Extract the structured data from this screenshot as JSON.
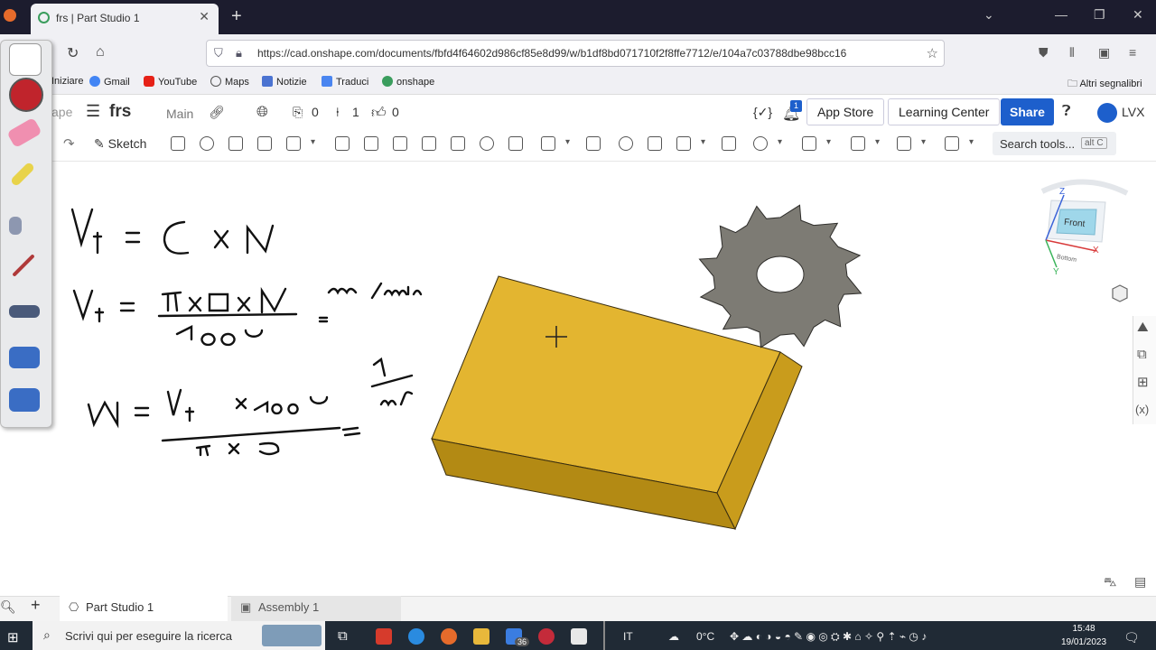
{
  "browser": {
    "tab_title": "frs | Part Studio 1",
    "tab_close": "✕",
    "new_tab": "+",
    "url": "https://cad.onshape.com/documents/fbfd4f64602d986cf85e8d99/w/b1df8bd071710f2f8ffe7712/e/104a7c03788dbe98bcc16",
    "bookmarks": [
      "Iniziare",
      "Gmail",
      "YouTube",
      "Maps",
      "Notizie",
      "Traduci",
      "onshape"
    ],
    "other_bookmarks": "Altri segnalibri"
  },
  "onshape": {
    "logo_fragment": "ape",
    "doc_name": "frs",
    "branch": "Main",
    "count_copies": "0",
    "count_versions": "1",
    "count_likes": "0",
    "notification_badge": "1",
    "app_store": "App Store",
    "learning_center": "Learning Center",
    "share": "Share",
    "user": "LVX",
    "toolbar_sketch": "Sketch",
    "search_tools": "Search tools...",
    "search_shortcut": "alt C",
    "view_cube": {
      "front": "Front",
      "bottom": "Bottom",
      "z": "Z",
      "x": "X",
      "y": "Y"
    }
  },
  "handwriting": {
    "line1": "Vt = C x N",
    "line2_num": "π x D x N",
    "line2_den": "1000",
    "line2_unit": "m/min",
    "line3_num": "Vt x 1000",
    "line3_den": "π x D",
    "line3_unit": "1/min"
  },
  "bottom_tabs": [
    "Part Studio 1",
    "Assembly 1"
  ],
  "taskbar": {
    "search_placeholder": "Scrivi qui per eseguire la ricerca",
    "lang": "IT",
    "weather": "0°C",
    "time": "15:48",
    "date": "19/01/2023",
    "mail_badge": "36"
  },
  "colors": {
    "accent": "#1d5fcc",
    "block": "#e3b530",
    "cutter": "#7d7b74"
  }
}
